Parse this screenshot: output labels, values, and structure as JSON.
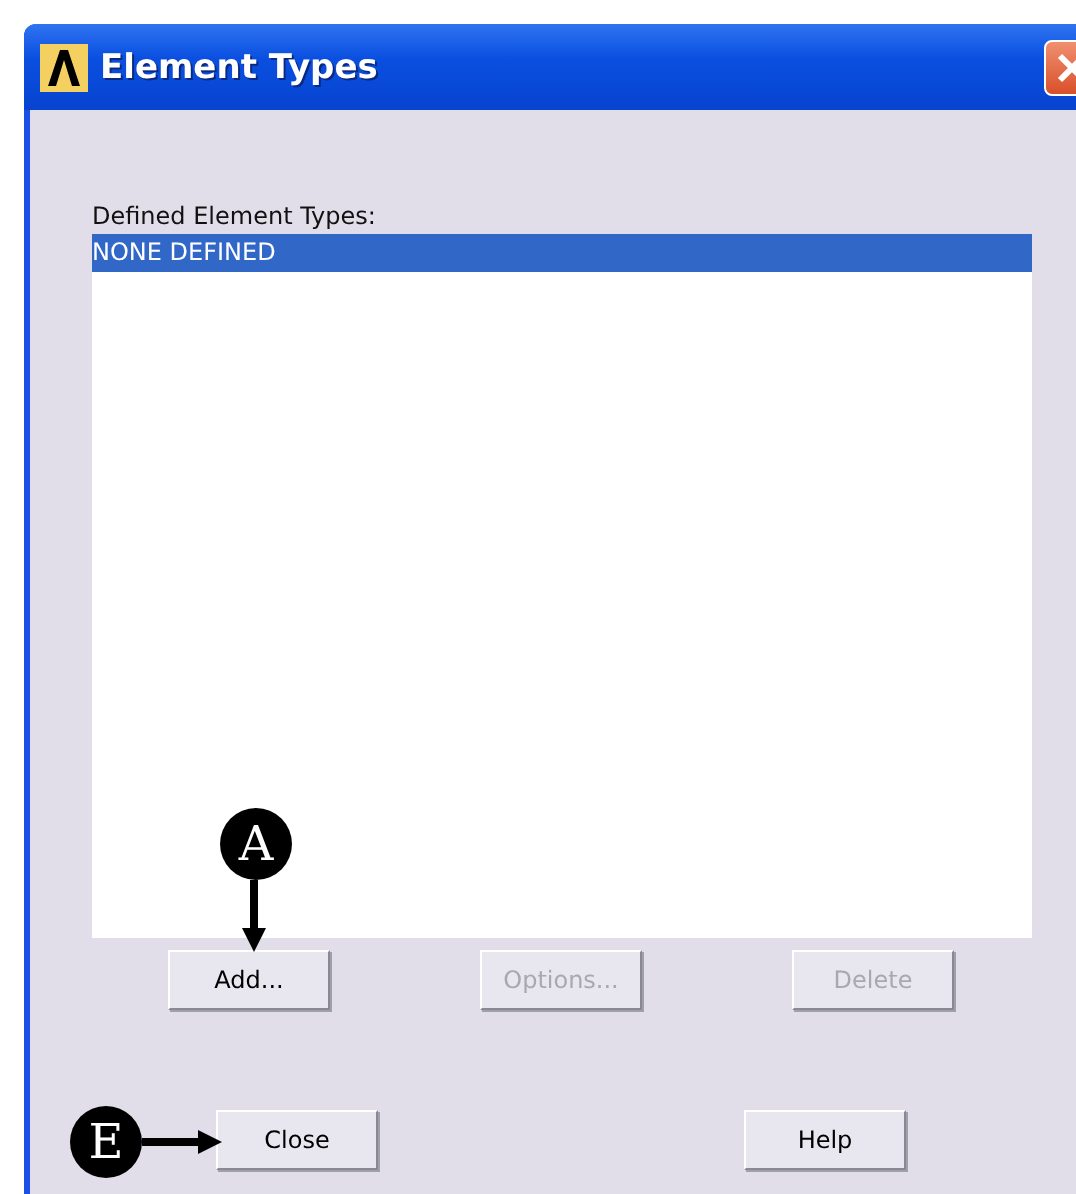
{
  "window": {
    "title": "Element Types"
  },
  "list": {
    "label": "Defined Element Types:",
    "items": [
      {
        "text": "NONE DEFINED",
        "selected": true
      }
    ]
  },
  "list_buttons": [
    {
      "label": "Add...",
      "disabled": false
    },
    {
      "label": "Options...",
      "disabled": true
    },
    {
      "label": "Delete",
      "disabled": true
    }
  ],
  "dialog_buttons": [
    {
      "label": "Close",
      "disabled": false
    },
    {
      "label": "Help",
      "disabled": false
    }
  ],
  "annotations": [
    {
      "label": "A",
      "kind": "down"
    },
    {
      "label": "E",
      "kind": "right"
    }
  ]
}
